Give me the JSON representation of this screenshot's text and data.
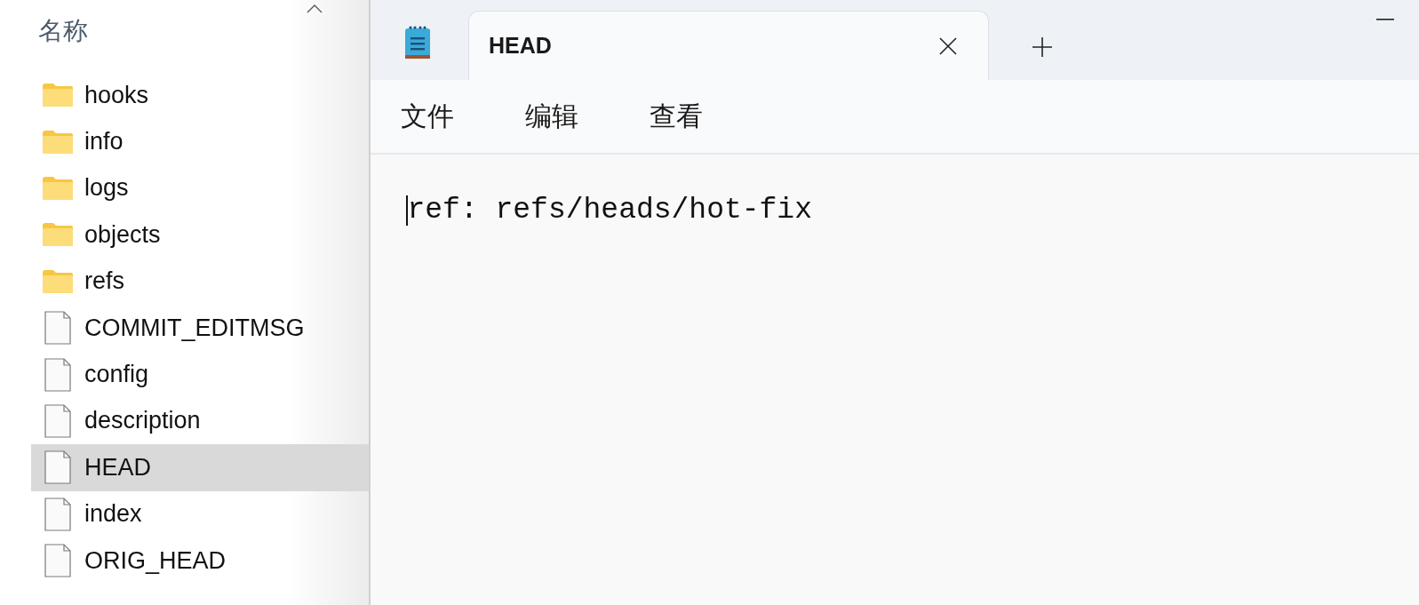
{
  "explorer": {
    "column_header": "名称",
    "items": [
      {
        "name": "hooks",
        "kind": "folder",
        "selected": false
      },
      {
        "name": "info",
        "kind": "folder",
        "selected": false
      },
      {
        "name": "logs",
        "kind": "folder",
        "selected": false
      },
      {
        "name": "objects",
        "kind": "folder",
        "selected": false
      },
      {
        "name": "refs",
        "kind": "folder",
        "selected": false
      },
      {
        "name": "COMMIT_EDITMSG",
        "kind": "file",
        "selected": false
      },
      {
        "name": "config",
        "kind": "file",
        "selected": false
      },
      {
        "name": "description",
        "kind": "file",
        "selected": false
      },
      {
        "name": "HEAD",
        "kind": "file",
        "selected": true
      },
      {
        "name": "index",
        "kind": "file",
        "selected": false
      },
      {
        "name": "ORIG_HEAD",
        "kind": "file",
        "selected": false
      }
    ]
  },
  "notepad": {
    "tabs": [
      {
        "label": "HEAD",
        "selected": true
      }
    ],
    "menu": [
      "文件",
      "编辑",
      "查看"
    ],
    "text": "ref: refs/heads/hot-fix"
  }
}
